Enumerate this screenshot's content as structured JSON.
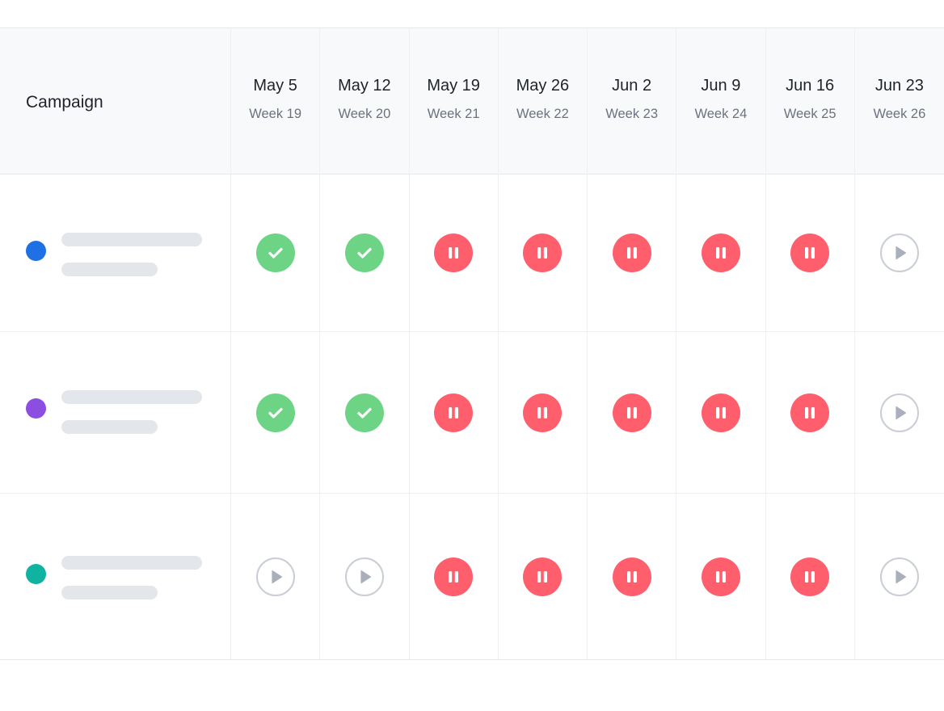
{
  "header": {
    "campaign_label": "Campaign"
  },
  "weeks": [
    {
      "date": "May 5",
      "week": "Week 19"
    },
    {
      "date": "May 12",
      "week": "Week 20"
    },
    {
      "date": "May 19",
      "week": "Week 21"
    },
    {
      "date": "May 26",
      "week": "Week 22"
    },
    {
      "date": "Jun 2",
      "week": "Week 23"
    },
    {
      "date": "Jun 9",
      "week": "Week 24"
    },
    {
      "date": "Jun 16",
      "week": "Week 25"
    },
    {
      "date": "Jun 23",
      "week": "Week 26"
    }
  ],
  "campaigns": [
    {
      "color": "#1f6fe5",
      "statuses": [
        "check-icon",
        "check-icon",
        "pause-icon",
        "pause-icon",
        "pause-icon",
        "pause-icon",
        "pause-icon",
        "play-icon"
      ]
    },
    {
      "color": "#8b4ee0",
      "statuses": [
        "check-icon",
        "check-icon",
        "pause-icon",
        "pause-icon",
        "pause-icon",
        "pause-icon",
        "pause-icon",
        "play-icon"
      ]
    },
    {
      "color": "#0fb3a0",
      "statuses": [
        "play-icon",
        "play-icon",
        "pause-icon",
        "pause-icon",
        "pause-icon",
        "pause-icon",
        "pause-icon",
        "play-icon"
      ]
    }
  ],
  "colors": {
    "check": "#6dd486",
    "pause": "#ff5f6d",
    "play_border": "#c9ced6",
    "play_fill": "#a9b0bc"
  }
}
